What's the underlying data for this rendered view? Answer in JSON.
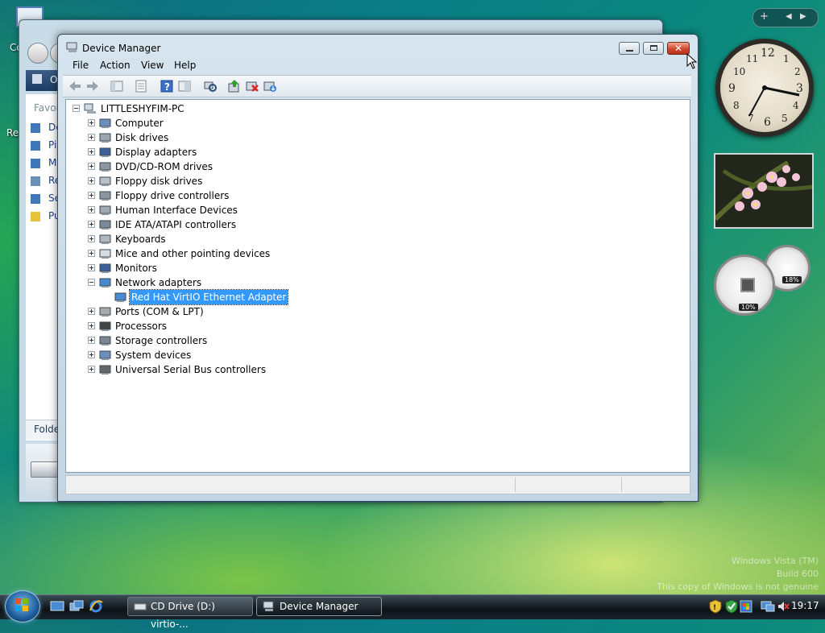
{
  "desktop": {
    "icon_label_1": "Co",
    "icon_label_2": "Re"
  },
  "explorer_bg": {
    "nav_label": "O",
    "favorites_label": "Favor",
    "links": [
      "De",
      "Pi",
      "M",
      "Re",
      "Se",
      "Pu"
    ],
    "folders_label": "Folde"
  },
  "device_manager": {
    "title": "Device Manager",
    "menu": [
      "File",
      "Action",
      "View",
      "Help"
    ],
    "root": "LITTLESHYFIM-PC",
    "categories": [
      {
        "label": "Computer",
        "expanded": false
      },
      {
        "label": "Disk drives",
        "expanded": false
      },
      {
        "label": "Display adapters",
        "expanded": false
      },
      {
        "label": "DVD/CD-ROM drives",
        "expanded": false
      },
      {
        "label": "Floppy disk drives",
        "expanded": false
      },
      {
        "label": "Floppy drive controllers",
        "expanded": false
      },
      {
        "label": "Human Interface Devices",
        "expanded": false
      },
      {
        "label": "IDE ATA/ATAPI controllers",
        "expanded": false
      },
      {
        "label": "Keyboards",
        "expanded": false
      },
      {
        "label": "Mice and other pointing devices",
        "expanded": false
      },
      {
        "label": "Monitors",
        "expanded": false
      },
      {
        "label": "Network adapters",
        "expanded": true
      },
      {
        "label": "Red Hat VirtIO Ethernet Adapter",
        "child": true,
        "selected": true
      },
      {
        "label": "Ports (COM & LPT)",
        "expanded": false
      },
      {
        "label": "Processors",
        "expanded": false
      },
      {
        "label": "Storage controllers",
        "expanded": false
      },
      {
        "label": "System devices",
        "expanded": false
      },
      {
        "label": "Universal Serial Bus controllers",
        "expanded": false
      }
    ],
    "toolbar_icons": [
      "back-icon",
      "forward-icon",
      "up-view-icon",
      "properties-icon",
      "help-icon",
      "view-icon",
      "scan-hardware-icon",
      "update-driver-icon",
      "uninstall-icon",
      "disable-icon"
    ]
  },
  "sidebar": {
    "cpu_percent": "10%",
    "mem_percent": "18%"
  },
  "taskbar": {
    "tasks": [
      "CD Drive (D:) virtio-...",
      "Device Manager"
    ],
    "clock": "19:17"
  },
  "watermark": {
    "line1": "Windows Vista (TM)",
    "line2": "Build 600",
    "line3": "This copy of Windows is not genuine"
  }
}
